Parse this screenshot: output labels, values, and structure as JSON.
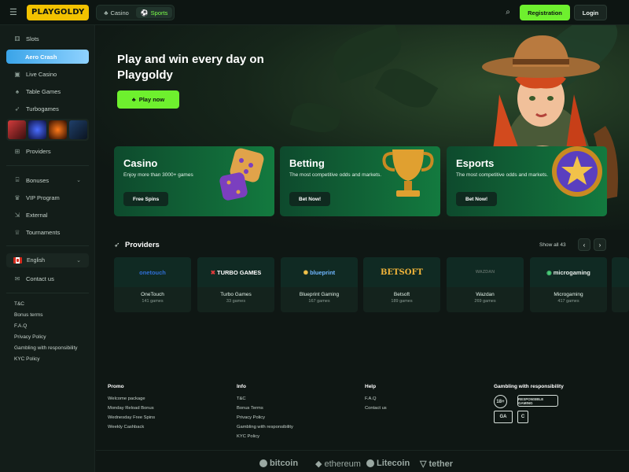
{
  "header": {
    "logo": "PLAYGOLDY",
    "modes": [
      {
        "label": "Casino",
        "active": false
      },
      {
        "label": "Sports",
        "active": true
      }
    ],
    "registration_label": "Registration",
    "login_label": "Login"
  },
  "sidebar": {
    "items": [
      {
        "label": "Slots",
        "icon": "slot-machine-icon"
      },
      {
        "label": "Aero Crash",
        "icon": "plane-icon"
      },
      {
        "label": "Live Casino",
        "icon": "live-casino-icon"
      },
      {
        "label": "Table Games",
        "icon": "cards-icon"
      },
      {
        "label": "Turbogames",
        "icon": "rocket-icon"
      },
      {
        "label": "Providers",
        "icon": "gamepad-icon"
      }
    ],
    "secondary": [
      {
        "label": "Bonuses",
        "icon": "gift-icon"
      },
      {
        "label": "VIP Program",
        "icon": "crown-icon"
      },
      {
        "label": "External",
        "icon": "external-icon"
      },
      {
        "label": "Tournaments",
        "icon": "trophy-icon"
      }
    ],
    "language": "English",
    "contact": "Contact us",
    "links": [
      "T&C",
      "Bonus terms",
      "F.A.Q",
      "Privacy Policy",
      "Gambling with responsibility",
      "KYC Policy"
    ]
  },
  "hero": {
    "title": "Play and win every day on Playgoldy",
    "play_label": "Play now"
  },
  "categories": [
    {
      "title": "Casino",
      "subtitle": "Enjoy more than 3000+ games",
      "button": "Free Spins"
    },
    {
      "title": "Betting",
      "subtitle": "The most competitive odds and markets.",
      "button": "Bet Now!"
    },
    {
      "title": "Esports",
      "subtitle": "The most competitive odds and markets.",
      "button": "Bet Now!"
    }
  ],
  "providers": {
    "title": "Providers",
    "show_all": "Show all 43",
    "items": [
      {
        "name": "OneTouch",
        "count": "141 games",
        "logo": "onetouch",
        "color": "#2f6fd6"
      },
      {
        "name": "Turbo Games",
        "count": "33 games",
        "logo": "TURBO GAMES",
        "color": "#ffffff"
      },
      {
        "name": "Blueprint Gaming",
        "count": "167 games",
        "logo": "blueprint",
        "color": "#6fb6ff"
      },
      {
        "name": "Betsoft",
        "count": "189 games",
        "logo": "BETSOFT",
        "color": "#f2b53a"
      },
      {
        "name": "Wazdan",
        "count": "269 games",
        "logo": "WAZDAN",
        "color": "#5a6a63"
      },
      {
        "name": "Microgaming",
        "count": "417 games",
        "logo": "microgaming",
        "color": "#e8efeb"
      }
    ]
  },
  "footer": {
    "promo": {
      "title": "Promo",
      "links": [
        "Welcome package",
        "Monday Reload Bonus",
        "Wednesday Free Spins",
        "Weekly Cashback"
      ]
    },
    "info": {
      "title": "Info",
      "links": [
        "T&C",
        "Bonus Terms",
        "Privacy Policy",
        "Gambling with responsibility",
        "KYC Policy"
      ]
    },
    "help": {
      "title": "Help",
      "links": [
        "F.A.Q",
        "Contact us"
      ]
    },
    "responsibility_title": "Gambling with responsibility",
    "badges": {
      "age": "18+",
      "rg": "RESPONSIBLE GAMING",
      "ga": "GA"
    },
    "crypto": [
      "bitcoin",
      "ethereum",
      "Litecoin",
      "tether"
    ]
  }
}
